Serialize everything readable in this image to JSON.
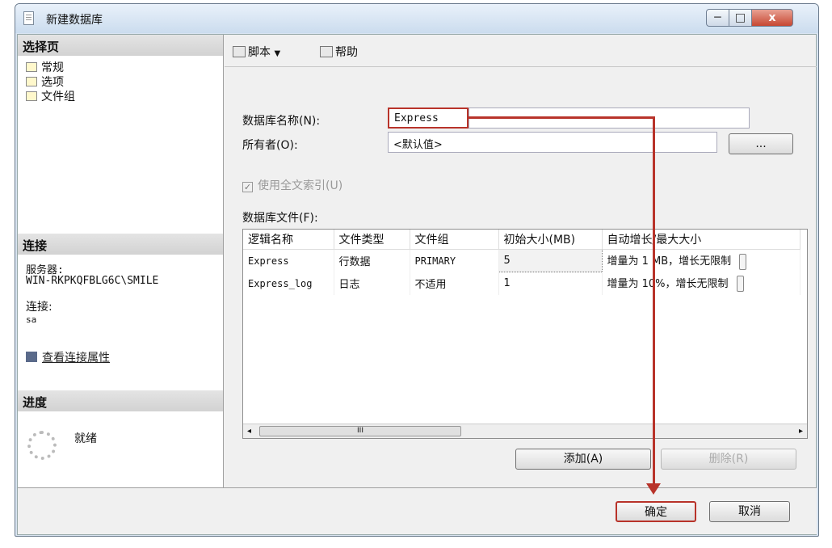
{
  "window": {
    "title": "新建数据库",
    "min": "─",
    "max": "□",
    "close": "x"
  },
  "left": {
    "select_page": "选择页",
    "pages": [
      "常规",
      "选项",
      "文件组"
    ],
    "connection_head": "连接",
    "server_label": "服务器:",
    "server_value": "WIN-RKPKQFBLG6C\\SMILE",
    "connection_label": "连接:",
    "connection_value": "sa",
    "view_props": "查看连接属性",
    "progress_head": "进度",
    "progress_status": "就绪"
  },
  "toolbar": {
    "script": "脚本",
    "script_arrow": "▼",
    "help": "帮助"
  },
  "form": {
    "db_name_label": "数据库名称(N):",
    "db_name_value": "Express",
    "owner_label": "所有者(O):",
    "owner_value": "<默认值>",
    "browse": "...",
    "fulltext": "使用全文索引(U)",
    "fulltext_check": "✓",
    "files_label": "数据库文件(F):"
  },
  "files": {
    "headers": [
      "逻辑名称",
      "文件类型",
      "文件组",
      "初始大小(MB)",
      "自动增长/最大大小"
    ],
    "rows": [
      [
        "Express",
        "行数据",
        "PRIMARY",
        "5",
        "增量为 1 MB，增长无限制"
      ],
      [
        "Express_log",
        "日志",
        "不适用",
        "1",
        "增量为 10%，增长无限制"
      ]
    ],
    "scroll_left": "◂",
    "scroll_right": "▸",
    "scroll_thumb": "III"
  },
  "buttons": {
    "add": "添加(A)",
    "remove": "删除(R)",
    "ok": "确定",
    "cancel": "取消"
  }
}
